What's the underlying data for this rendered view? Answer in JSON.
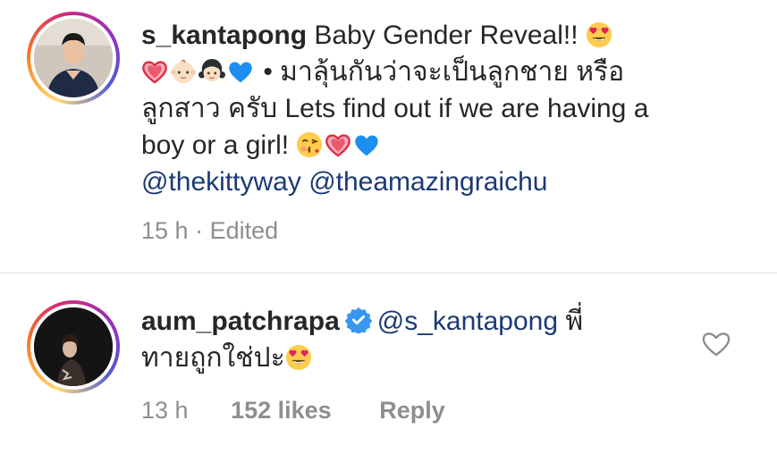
{
  "post_caption": {
    "username": "s_kantapong",
    "title_text": "Baby Gender Reveal!!",
    "thai_line_1": "• มาลุ้นกันว่าจะเป็นลูกชาย หรือ",
    "thai_line_2": "ลูกสาว ครับ",
    "english_text_1": "Lets find out if we are having a",
    "english_text_2": "boy or a girl!",
    "mention_1": "@thekittyway",
    "mention_2": "@theamazingraichu",
    "time": "15 h",
    "separator": "·",
    "edited": "Edited",
    "emoji": {
      "heart_eyes": "smiling-face-heart-eyes-icon",
      "pink_heart": "sparkling-heart-icon",
      "baby": "baby-icon",
      "girl": "girl-icon",
      "blue_heart": "blue-heart-icon",
      "kiss": "face-blowing-kiss-icon"
    }
  },
  "reply_comment": {
    "username": "aum_patchrapa",
    "verified_icon": "verified-badge-icon",
    "mention": "@s_kantapong",
    "text_line_1": "พี่",
    "text_line_2": "ทายถูกใช่ปะ",
    "time": "13 h",
    "likes": "152 likes",
    "reply_label": "Reply",
    "like_icon": "heart-outline-icon"
  },
  "colors": {
    "text": "#262626",
    "secondary": "#8e8e8e",
    "mention": "#1b3a75",
    "verified": "#3897f0",
    "divider": "#dbdbdb"
  }
}
